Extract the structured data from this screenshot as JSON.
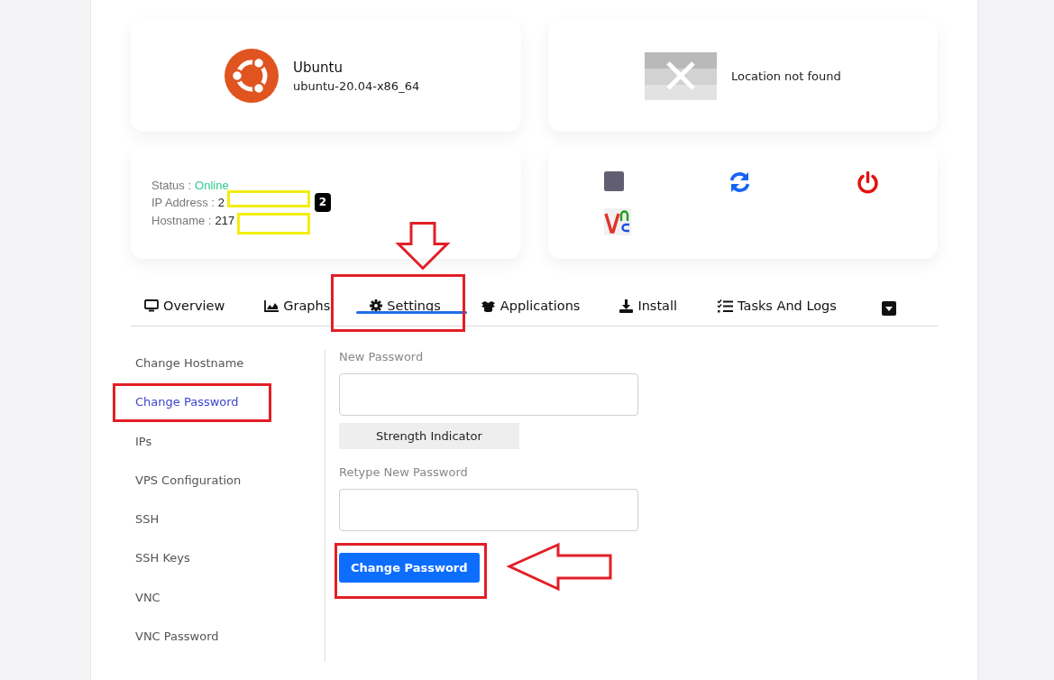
{
  "os_card": {
    "name": "Ubuntu",
    "template": "ubuntu-20.04-x86_64"
  },
  "location_card": {
    "text": "Location not found"
  },
  "info_card": {
    "status_label": "Status :",
    "status_value": "Online",
    "ip_label": "IP Address :",
    "ip_value": "2",
    "hostname_label": "Hostname :",
    "hostname_value": "217",
    "step_badge": "2"
  },
  "tabs": [
    {
      "label": "Overview",
      "kind": "monitor",
      "selected": false
    },
    {
      "label": "Graphs",
      "kind": "chart",
      "selected": false
    },
    {
      "label": "Settings",
      "kind": "gear",
      "selected": true
    },
    {
      "label": "Applications",
      "kind": "boxes",
      "selected": false
    },
    {
      "label": "Install",
      "kind": "download",
      "selected": false
    },
    {
      "label": "Tasks And Logs",
      "kind": "tasks",
      "selected": false
    }
  ],
  "settings_menu": [
    {
      "label": "Change Hostname",
      "selected": false
    },
    {
      "label": "Change Password",
      "selected": true
    },
    {
      "label": "IPs",
      "selected": false
    },
    {
      "label": "VPS Configuration",
      "selected": false
    },
    {
      "label": "SSH",
      "selected": false
    },
    {
      "label": "SSH Keys",
      "selected": false
    },
    {
      "label": "VNC",
      "selected": false
    },
    {
      "label": "VNC Password",
      "selected": false
    }
  ],
  "password_form": {
    "new_label": "New Password",
    "strength": "Strength Indicator",
    "retype_label": "Retype New Password",
    "submit": "Change Password"
  }
}
